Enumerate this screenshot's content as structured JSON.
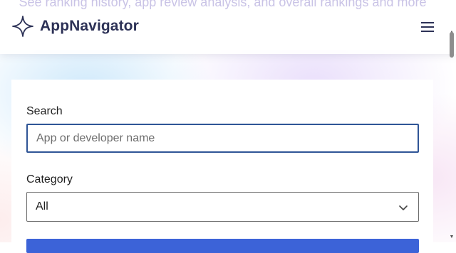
{
  "hero": {
    "subtitle": "See ranking history, app review analysis, and overall rankings and more"
  },
  "header": {
    "brand": "AppNavigator",
    "logo_icon": "sparkle-star-icon",
    "menu_icon": "hamburger-menu-icon"
  },
  "form": {
    "search_label": "Search",
    "search_placeholder": "App or developer name",
    "search_value": "",
    "category_label": "Category",
    "category_value": "All",
    "category_icon": "chevron-down-icon",
    "submit_color": "#3c63d8"
  },
  "colors": {
    "brand_text": "#2c3156",
    "focus_border": "#2f5596",
    "accent": "#3c63d8"
  }
}
